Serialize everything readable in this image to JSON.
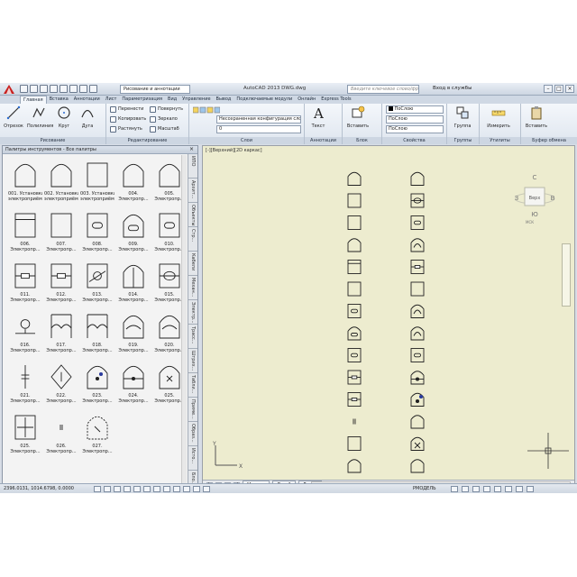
{
  "title_bar": {
    "workspace": "Рисование и аннотации",
    "app_title": "AutoCAD 2013    DWG.dwg",
    "search_placeholder": "Введите ключевое слово/фразу",
    "signin": "Вход в службы"
  },
  "ribbon_tabs": [
    "Главная",
    "Вставка",
    "Аннотации",
    "Лист",
    "Параметризация",
    "Вид",
    "Управление",
    "Вывод",
    "Подключаемые модули",
    "Онлайн",
    "Express Tools"
  ],
  "ribbon": {
    "draw_panel": {
      "title": "Рисование",
      "buttons": [
        "Отрезок",
        "Полилиния",
        "Круг",
        "Дуга"
      ]
    },
    "modify_panel": {
      "title": "Редактирование",
      "items": [
        "Перенести",
        "Повернуть",
        "Копировать",
        "Зеркало",
        "Растянуть",
        "Масштаб"
      ]
    },
    "layers_panel": {
      "title": "Слои",
      "state": "Несохраненная конфигурация слое",
      "layer": "0"
    },
    "annotation_panel": {
      "title": "Аннотации",
      "text": "Текст"
    },
    "block_panel": {
      "title": "Блок",
      "insert": "Вставить"
    },
    "properties_panel": {
      "title": "Свойства",
      "color": "ПоСлою",
      "linetype": "ПоСлою",
      "lineweight": "ПоСлою"
    },
    "groups_panel": {
      "title": "Группы",
      "button": "Группа"
    },
    "utilities_panel": {
      "title": "Утилиты",
      "button": "Измерить"
    },
    "clipboard_panel": {
      "title": "Буфер обмена",
      "button": "Вставить"
    }
  },
  "palette": {
    "title": "Палитры инструментов - Все палитры",
    "tabs": [
      "ИПО",
      "Архит...",
      "Объекты",
      "Стр...",
      "Кабели",
      "Механ...",
      "Электр...",
      "Трасс...",
      "Штрих...",
      "Табли...",
      "Приме...",
      "Образ...",
      "Исто...",
      "Бло..."
    ],
    "items": [
      {
        "label1": "001. Установка",
        "label2": "электроприёмни...",
        "shape": "arch"
      },
      {
        "label1": "002. Установка",
        "label2": "электроприёмни...",
        "shape": "arch"
      },
      {
        "label1": "003. Установка",
        "label2": "электроприёмни...",
        "shape": "rect"
      },
      {
        "label1": "004.",
        "label2": "Электропр...",
        "shape": "arch"
      },
      {
        "label1": "005.",
        "label2": "Электропр...",
        "shape": "arch"
      },
      {
        "label1": "006.",
        "label2": "Электропр...",
        "shape": "rect-top"
      },
      {
        "label1": "007.",
        "label2": "Электропр...",
        "shape": "rect"
      },
      {
        "label1": "008.",
        "label2": "Электропр...",
        "shape": "pill"
      },
      {
        "label1": "009.",
        "label2": "Электропр...",
        "shape": "arch-pill"
      },
      {
        "label1": "010.",
        "label2": "Электропр...",
        "shape": "pill"
      },
      {
        "label1": "011.",
        "label2": "Электропр...",
        "shape": "res"
      },
      {
        "label1": "012.",
        "label2": "Электропр...",
        "shape": "res"
      },
      {
        "label1": "013.",
        "label2": "Электропр...",
        "shape": "motor"
      },
      {
        "label1": "014.",
        "label2": "Электропр...",
        "shape": "split"
      },
      {
        "label1": "015.",
        "label2": "Электропр...",
        "shape": "oval"
      },
      {
        "label1": "016.",
        "label2": "Электропр...",
        "shape": "lamp"
      },
      {
        "label1": "017.",
        "label2": "Электропр...",
        "shape": "wave"
      },
      {
        "label1": "018.",
        "label2": "Электропр...",
        "shape": "wave"
      },
      {
        "label1": "019.",
        "label2": "Электропр...",
        "shape": "archwave"
      },
      {
        "label1": "020.",
        "label2": "Электропр...",
        "shape": "archwave"
      },
      {
        "label1": "021.",
        "label2": "Электропр...",
        "shape": "cap"
      },
      {
        "label1": "022.",
        "label2": "Электропр...",
        "shape": "diamond"
      },
      {
        "label1": "023.",
        "label2": "Электропр...",
        "shape": "dots"
      },
      {
        "label1": "024.",
        "label2": "Электропр...",
        "shape": "archdot"
      },
      {
        "label1": "025.",
        "label2": "Электропр...",
        "shape": "archx"
      },
      {
        "label1": "025.",
        "label2": "Электропр...",
        "shape": "arrows"
      },
      {
        "label1": "026.",
        "label2": "Электропр...",
        "shape": "plug"
      },
      {
        "label1": "027.",
        "label2": "Электропр...",
        "shape": "dashed"
      }
    ]
  },
  "drawing": {
    "viewport_label": "[-][Верхний][2D каркас]",
    "viewcube": {
      "top": "Верх",
      "north": "С",
      "south": "Ю",
      "west": "З",
      "east": "В",
      "wcs": "МСК"
    },
    "ucs_x": "X",
    "ucs_y": "Y",
    "layout_tabs": [
      "Модель",
      "Лист1",
      "Лист2"
    ]
  },
  "status_bar": {
    "coords": "2396.0131, 1014.6798, 0.0000",
    "space": "РМОДЕЛЬ"
  }
}
